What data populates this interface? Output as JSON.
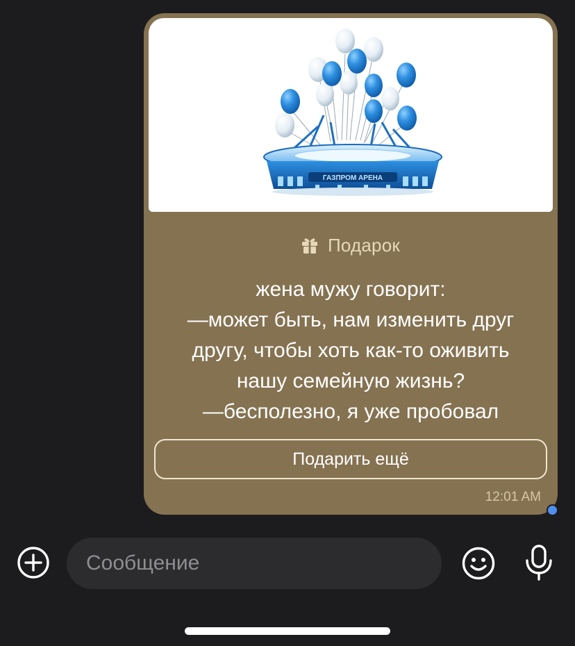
{
  "message": {
    "gift_image_icon": "stadium-with-balloons",
    "gift_image_logo_text": "ГАЗПРОМ АРЕНА",
    "gift_icon": "gift-icon",
    "gift_title": "Подарок",
    "text_lines": [
      "жена мужу говорит:",
      "—может быть, нам изменить друг",
      "другу, чтобы хоть как-то оживить",
      "нашу семейную жизнь?",
      "—бесполезно, я уже пробовал"
    ],
    "gift_again_label": "Подарить ещё",
    "time": "12:01 AM",
    "bubble_color": "#857251"
  },
  "composer": {
    "add_icon": "plus-circle-icon",
    "placeholder": "Сообщение",
    "value": "",
    "emoji_icon": "smiley-icon",
    "mic_icon": "microphone-icon"
  },
  "colors": {
    "background": "#1c1c1e",
    "input_background": "#2c2c2e",
    "accent_unread_dot": "#4f8ff0"
  }
}
